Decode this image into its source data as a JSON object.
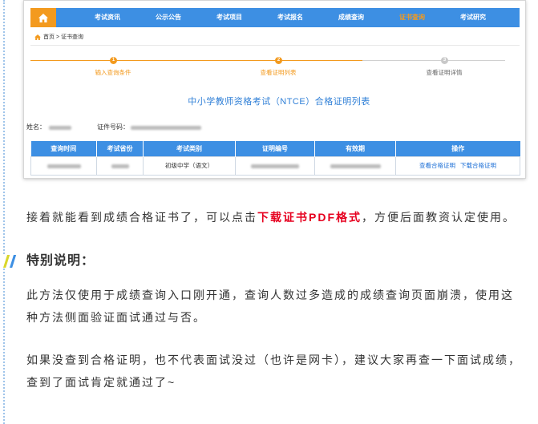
{
  "article": {
    "screenshot": {
      "nav": {
        "home_icon": "home-icon",
        "items": [
          {
            "label": "考试资讯",
            "active": false
          },
          {
            "label": "公示公告",
            "active": false
          },
          {
            "label": "考试项目",
            "active": false
          },
          {
            "label": "考试报名",
            "active": false
          },
          {
            "label": "成绩查询",
            "active": false
          },
          {
            "label": "证书查询",
            "active": true
          },
          {
            "label": "考试研究",
            "active": false
          }
        ]
      },
      "breadcrumb": {
        "icon": "home-icon",
        "home": "首页",
        "separator": ">",
        "current": "证书查询"
      },
      "steps": [
        {
          "number": "1",
          "label": "输入查询条件",
          "state": "done"
        },
        {
          "number": "2",
          "label": "查看证明列表",
          "state": "current"
        },
        {
          "number": "3",
          "label": "查看证明详情",
          "state": "pending"
        }
      ],
      "title": "中小学教师资格考试（NTCE）合格证明列表",
      "name_label": "姓名：",
      "id_number_label": "证件号码：",
      "table": {
        "headers": [
          "查询时间",
          "考试省份",
          "考试类别",
          "证明编号",
          "有效期",
          "操作"
        ],
        "rows": [
          {
            "category": "初级中学（语文）",
            "actions": [
              "查看合格证明",
              "下载合格证明"
            ]
          }
        ]
      }
    },
    "paragraph_1": {
      "before": "接着就能看到成绩合格证书了，可以点击",
      "highlight": "下载证书PDF格式",
      "after": "，方便后面教资认定使用。"
    },
    "section_heading": {
      "icon": "double-slash-icon",
      "text": "特别说明："
    },
    "paragraph_2": "此方法仅使用于成绩查询入口刚开通，查询人数过多造成的成绩查询页面崩溃，使用这种方法侧面验证面试通过与否。",
    "paragraph_3": "如果没查到合格证明，也不代表面试没过（也许是网卡），建议大家再查一下面试成绩，查到了面试肯定就通过了~"
  },
  "colors": {
    "nav_blue": "#3d8fe3",
    "accent_orange": "#f39a1e",
    "title_blue": "#2f7fd7",
    "link_blue": "#1c6fd6",
    "highlight_red": "#e6001f",
    "text": "#333333",
    "rule_blue": "#9fc4ea",
    "marker_yellow": "#d9d62b"
  }
}
